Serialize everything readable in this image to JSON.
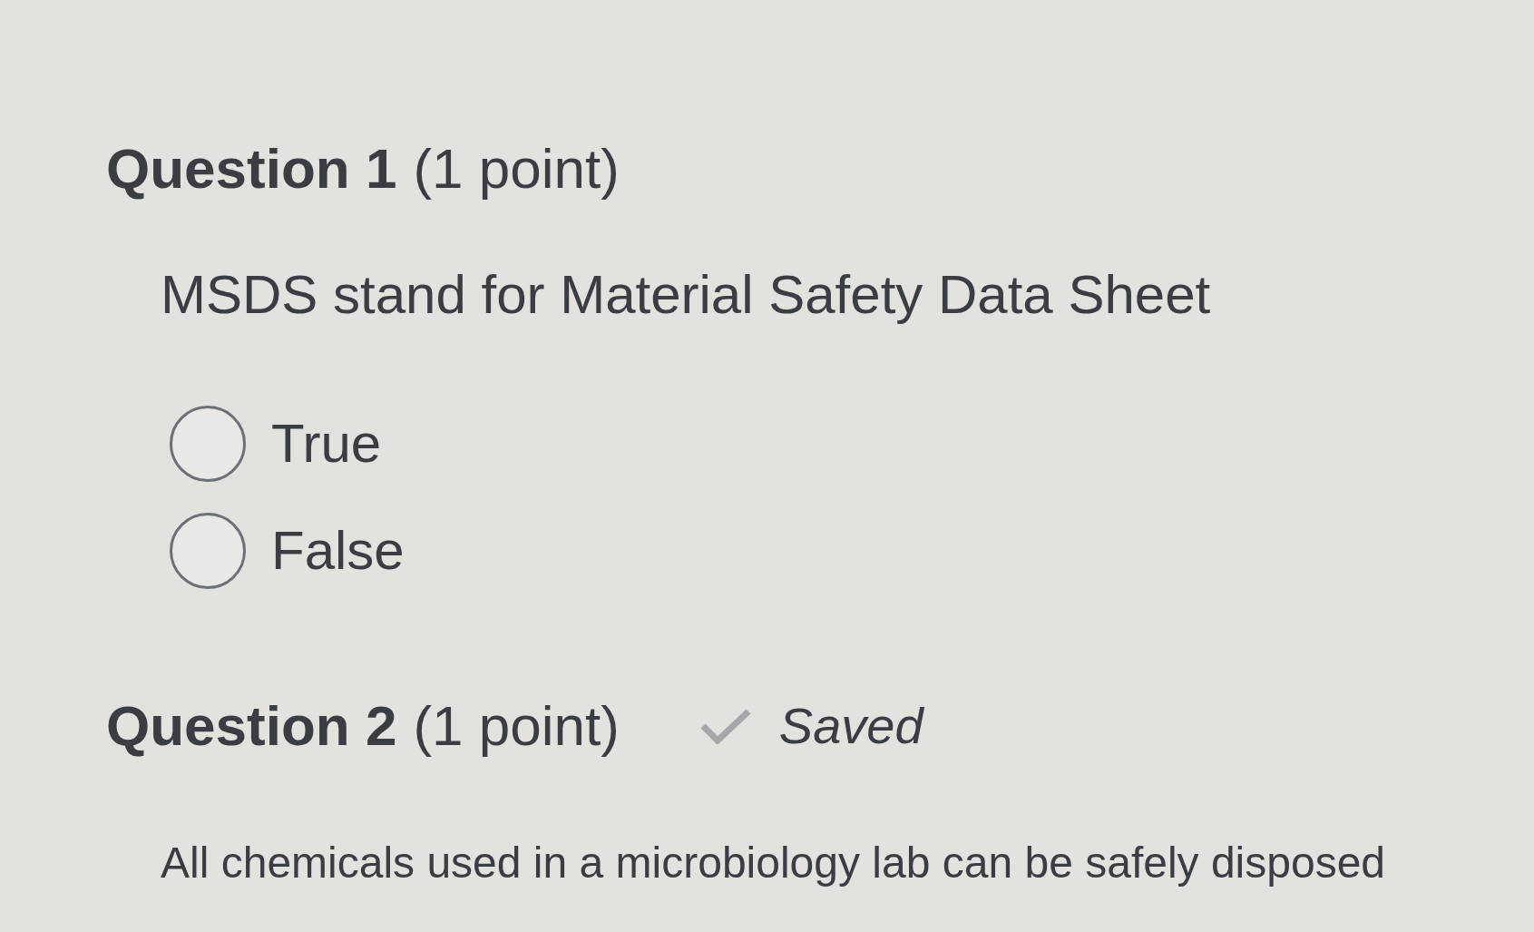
{
  "questions": [
    {
      "heading": "Question 1",
      "points": "(1 point)",
      "prompt": "MSDS stand for Material Safety Data Sheet",
      "options": [
        {
          "label": "True",
          "selected": false
        },
        {
          "label": "False",
          "selected": false
        }
      ]
    },
    {
      "heading": "Question 2",
      "points": "(1 point)",
      "status": "Saved",
      "prompt": "All chemicals used in a microbiology lab can be safely disposed"
    }
  ]
}
